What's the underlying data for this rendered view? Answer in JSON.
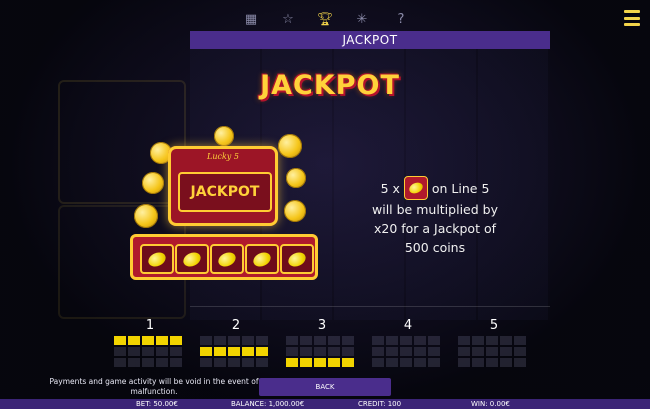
{
  "top_icons": [
    "reels-icon",
    "star-icon",
    "trophy-icon",
    "scatter-icon",
    "help-icon"
  ],
  "header": {
    "title": "JACKPOT"
  },
  "jackpot_heading": "JACKPOT",
  "machine": {
    "brand": "Lucky 5",
    "marquee_text": "JACKPOT"
  },
  "description": {
    "count": "5 x",
    "line": "on Line 5",
    "line2": "will be multiplied by",
    "line3": "x20 for a Jackpot of",
    "line4": "500 coins"
  },
  "patterns": [
    {
      "number": "1"
    },
    {
      "number": "2"
    },
    {
      "number": "3"
    },
    {
      "number": "4"
    },
    {
      "number": "5"
    }
  ],
  "footer": {
    "disclaimer": "Payments and game activity will be void in the event of malfunction.",
    "back_label": "BACK"
  },
  "status": {
    "bet": "BET: 50.00€",
    "balance": "BALANCE: 1,000.00€",
    "credit": "CREDIT: 100",
    "win": "WIN: 0.00€"
  },
  "colors": {
    "accent": "#4a2d8c",
    "gold": "#f2d400",
    "red": "#b01a2c"
  }
}
